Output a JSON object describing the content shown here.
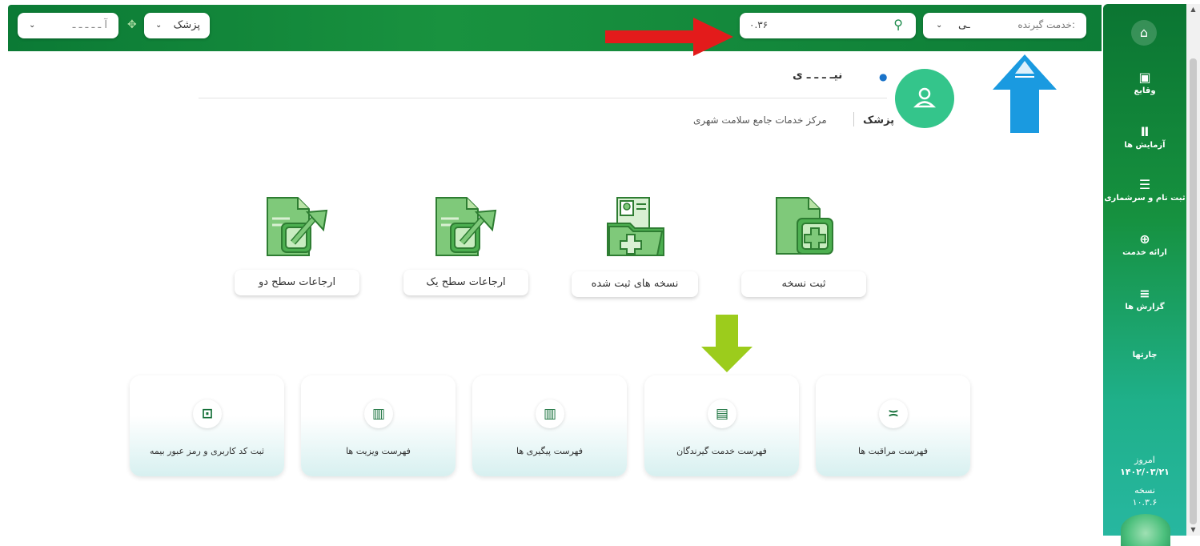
{
  "topbar": {
    "service_recipient_placeholder": "خدمت گیرنده:",
    "service_recipient_value": "ـی",
    "search_value": "۰.۳۶",
    "doctor_dropdown_label": "پزشک",
    "clinic_dropdown_label": "آ ـ ـ ـ ـ ـ"
  },
  "sidebar": {
    "items": [
      {
        "label": "وقایع",
        "icon": "calendar-icon"
      },
      {
        "label": "آزمایش ها",
        "icon": "test-tube-icon"
      },
      {
        "label": "ثبت نام و سرشماری",
        "icon": "people-list-icon"
      },
      {
        "label": "ارائه خدمت",
        "icon": "search-plus-icon"
      },
      {
        "label": "گزارش ها",
        "icon": "database-icon"
      },
      {
        "label": "چارتها",
        "icon": ""
      }
    ],
    "today_label": "امروز",
    "today_date": "۱۴۰۲/۰۳/۲۱",
    "version_label": "نسخه",
    "version_value": "۱۰.۳.۶"
  },
  "profile": {
    "name": "نیـ ـ ـ ـ ی",
    "role": "پزشک",
    "center": "مرکز خدمات جامع سلامت شهری"
  },
  "actions": [
    {
      "label": "ثبت نسخه",
      "icon": "prescription-add-icon"
    },
    {
      "label": "نسخه های ثبت شده",
      "icon": "registered-prescriptions-icon"
    },
    {
      "label": "ارجاعات سطح یک",
      "icon": "referral-level-one-icon"
    },
    {
      "label": "ارجاعات سطح دو",
      "icon": "referral-level-two-icon"
    }
  ],
  "cards": [
    {
      "label": "فهرست مراقبت ها",
      "icon": "list-check-icon"
    },
    {
      "label": "فهرست خدمت گیرندگان",
      "icon": "clipboard-icon"
    },
    {
      "label": "فهرست پیگیری ها",
      "icon": "clipboard-list-icon"
    },
    {
      "label": "فهرست ویزیت ها",
      "icon": "clipboard-list-icon"
    },
    {
      "label": "ثبت کد کاربری و رمز عبور بیمه",
      "icon": "lock-check-icon"
    }
  ],
  "colors": {
    "primary_green": "#16913f",
    "avatar_green": "#34c58b",
    "arrow_red": "#e31b1b",
    "arrow_blue": "#1a9ae0",
    "arrow_lime": "#9ccc1c"
  }
}
